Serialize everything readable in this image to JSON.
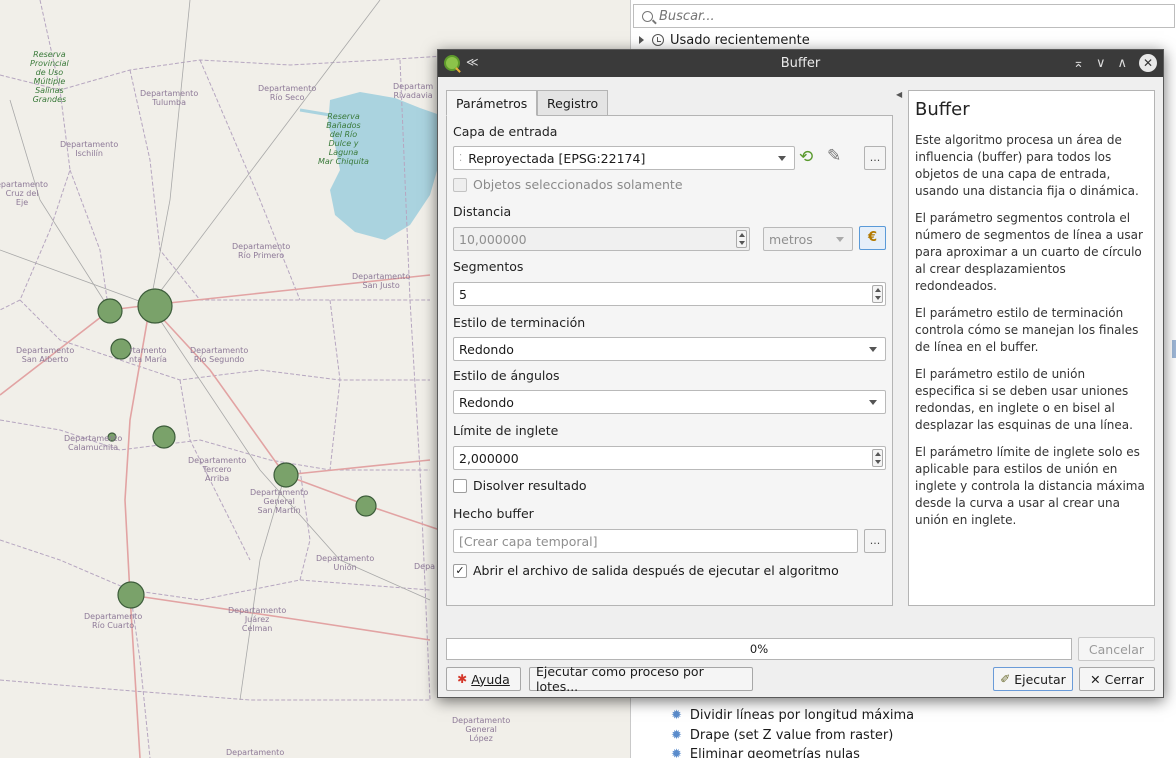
{
  "map": {
    "labels": [
      "Reserva\nProvincial\nde Uso\nMúltiple\nSalinas\nGrandes",
      "Departamento\nTulumba",
      "Departamento\nRío Seco",
      "Departam\nRivadavia",
      "Reserva\nBañados\ndel Río\nDulce y\nLaguna\nMar Chiquita",
      "Departamento\nIschilín",
      "epartamento\nCruz del\nEje",
      "Departamento\nRío Primero",
      "Departamento\nSan Justo",
      "Departamento\nSan Alberto",
      "rtamento\nnta María",
      "Departamento\nRío Segundo",
      "Departamento\nCalamuchita",
      "Departamento\nTercero\nArriba",
      "Departamento\nGeneral\nSan Martín",
      "Departamento\nUnión",
      "Depa",
      "Departamento\nRío Cuarto",
      "Departamento\nJuárez\nCelman",
      "Departamento\nGeneral\nLópez",
      "Departamento"
    ]
  },
  "toolbox": {
    "search_placeholder": "Buscar...",
    "recent_label": "Usado recientemente",
    "items": [
      "Dividir líneas por longitud máxima",
      "Drape (set Z value from raster)",
      "Eliminar geometrías nulas"
    ]
  },
  "dialog": {
    "title": "Buffer",
    "tabs": [
      "Parámetros",
      "Registro"
    ],
    "input_layer_label": "Capa de entrada",
    "input_layer_value": "Reproyectada [EPSG:22174]",
    "selected_only_label": "Objetos seleccionados solamente",
    "distance_label": "Distancia",
    "distance_value": "10,000000",
    "distance_unit": "metros",
    "segments_label": "Segmentos",
    "segments_value": "5",
    "end_cap_label": "Estilo de terminación",
    "end_cap_value": "Redondo",
    "join_label": "Estilo de ángulos",
    "join_value": "Redondo",
    "miter_label": "Límite de inglete",
    "miter_value": "2,000000",
    "dissolve_label": "Disolver resultado",
    "output_label": "Hecho buffer",
    "output_placeholder": "[Crear capa temporal]",
    "open_output_label": "Abrir el archivo de salida después de ejecutar el algoritmo",
    "more_btn": "...",
    "help": {
      "title": "Buffer",
      "paragraphs": [
        "Este algoritmo procesa un área de influencia (buffer) para todos los objetos de una capa de entrada, usando una distancia fija o dinámica.",
        "El parámetro segmentos controla el número de segmentos de línea a usar para aproximar a un cuarto de círculo al crear desplazamientos redondeados.",
        "El parámetro estilo de terminación controla cómo se manejan los finales de línea en el buffer.",
        "El parámetro estilo de unión especifica si se deben usar uniones redondas, en inglete o en bisel al desplazar las esquinas de una línea.",
        "El parámetro límite de inglete solo es aplicable para estilos de unión en inglete y controla la distancia máxima desde la curva a usar al crear una unión en inglete."
      ]
    },
    "progress": "0%",
    "cancel": "Cancelar",
    "help_btn": "Ayuda",
    "batch_btn": "Ejecutar como proceso por lotes...",
    "run_btn": "Ejecutar",
    "close_btn": "Cerrar"
  }
}
